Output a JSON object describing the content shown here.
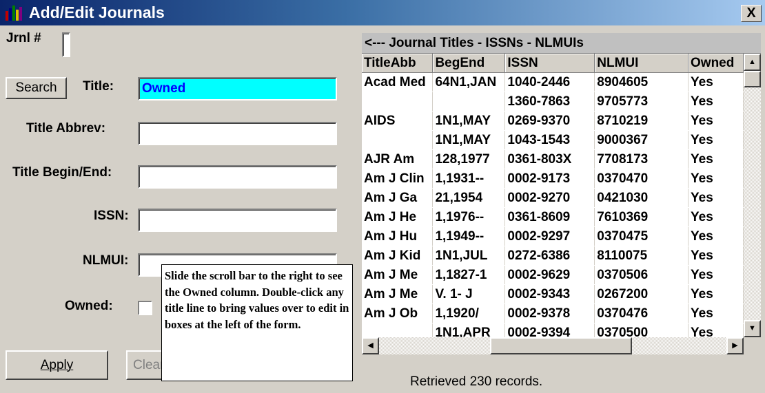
{
  "window": {
    "title": "Add/Edit Journals",
    "close_label": "X"
  },
  "form": {
    "jrnl_label": "Jrnl #",
    "search_label": "Search",
    "title_label": "Title:",
    "title_value": "Owned",
    "title_abbrev_label": "Title Abbrev:",
    "title_begin_end_label": "Title Begin/End:",
    "issn_label": "ISSN:",
    "nlmui_label": "NLMUI:",
    "owned_label": "Owned:",
    "apply_label": "Apply",
    "clear_label": "Clear"
  },
  "tooltip": {
    "text": "Slide the scroll bar to the right to see the Owned column.  Double-click any title line to bring values over to edit in boxes at the left of the form."
  },
  "grid": {
    "header": "<---   Journal Titles - ISSNs - NLMUIs",
    "columns": [
      "TitleAbb",
      "BegEnd",
      "ISSN",
      "NLMUI",
      "Owned"
    ],
    "rows": [
      [
        "Acad Med",
        "64N1,JAN",
        "1040-2446",
        "8904605",
        "Yes"
      ],
      [
        "",
        "",
        "1360-7863",
        "9705773",
        "Yes"
      ],
      [
        "AIDS",
        "1N1,MAY",
        "0269-9370",
        "8710219",
        "Yes"
      ],
      [
        "",
        "1N1,MAY",
        "1043-1543",
        "9000367",
        "Yes"
      ],
      [
        "AJR Am",
        "128,1977",
        "0361-803X",
        "7708173",
        "Yes"
      ],
      [
        "Am J Clin",
        "1,1931--",
        "0002-9173",
        "0370470",
        "Yes"
      ],
      [
        "Am J Ga",
        "21,1954",
        "0002-9270",
        "0421030",
        "Yes"
      ],
      [
        "Am J He",
        "1,1976--",
        "0361-8609",
        "7610369",
        "Yes"
      ],
      [
        "Am J Hu",
        "1,1949--",
        "0002-9297",
        "0370475",
        "Yes"
      ],
      [
        "Am J Kid",
        "1N1,JUL",
        "0272-6386",
        "8110075",
        "Yes"
      ],
      [
        "Am J Me",
        "1,1827-1",
        "0002-9629",
        "0370506",
        "Yes"
      ],
      [
        "Am J Me",
        "V. 1-   J",
        "0002-9343",
        "0267200",
        "Yes"
      ],
      [
        "Am J Ob",
        "1,1920/",
        "0002-9378",
        "0370476",
        "Yes"
      ],
      [
        "",
        "1N1,APR",
        "0002-9394",
        "0370500",
        "Yes"
      ]
    ]
  },
  "status": {
    "text": "Retrieved 230 records."
  }
}
